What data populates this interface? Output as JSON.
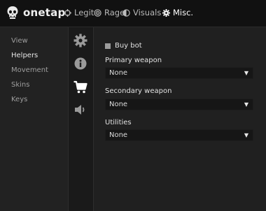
{
  "header": {
    "brand": "onetap",
    "tabs": [
      {
        "label": "Legit",
        "icon": "crosshair-icon"
      },
      {
        "label": "Rage",
        "icon": "target-icon"
      },
      {
        "label": "Visuals",
        "icon": "half-circle-icon"
      },
      {
        "label": "Misc.",
        "icon": "gear-icon",
        "active": true
      }
    ]
  },
  "sidebar": {
    "items": [
      {
        "label": "View"
      },
      {
        "label": "Helpers",
        "active": true
      },
      {
        "label": "Movement"
      },
      {
        "label": "Skins"
      },
      {
        "label": "Keys"
      }
    ]
  },
  "icon_column": {
    "icons": [
      "gear-icon",
      "info-icon",
      "shopping-cart-icon",
      "speaker-icon"
    ],
    "active_index": 2
  },
  "content": {
    "buybot": {
      "label": "Buy bot",
      "checked": false
    },
    "fields": [
      {
        "label": "Primary weapon",
        "value": "None"
      },
      {
        "label": "Secondary weapon",
        "value": "None"
      },
      {
        "label": "Utilities",
        "value": "None"
      }
    ],
    "dropdown_arrow": "▼"
  },
  "colors": {
    "header_bg": "#111111",
    "panel_bg": "#202020",
    "icon_column_bg": "#1a1a1a",
    "select_bg": "#161616",
    "text_active": "#e6e6e6",
    "text_inactive": "#9e9e9e"
  }
}
